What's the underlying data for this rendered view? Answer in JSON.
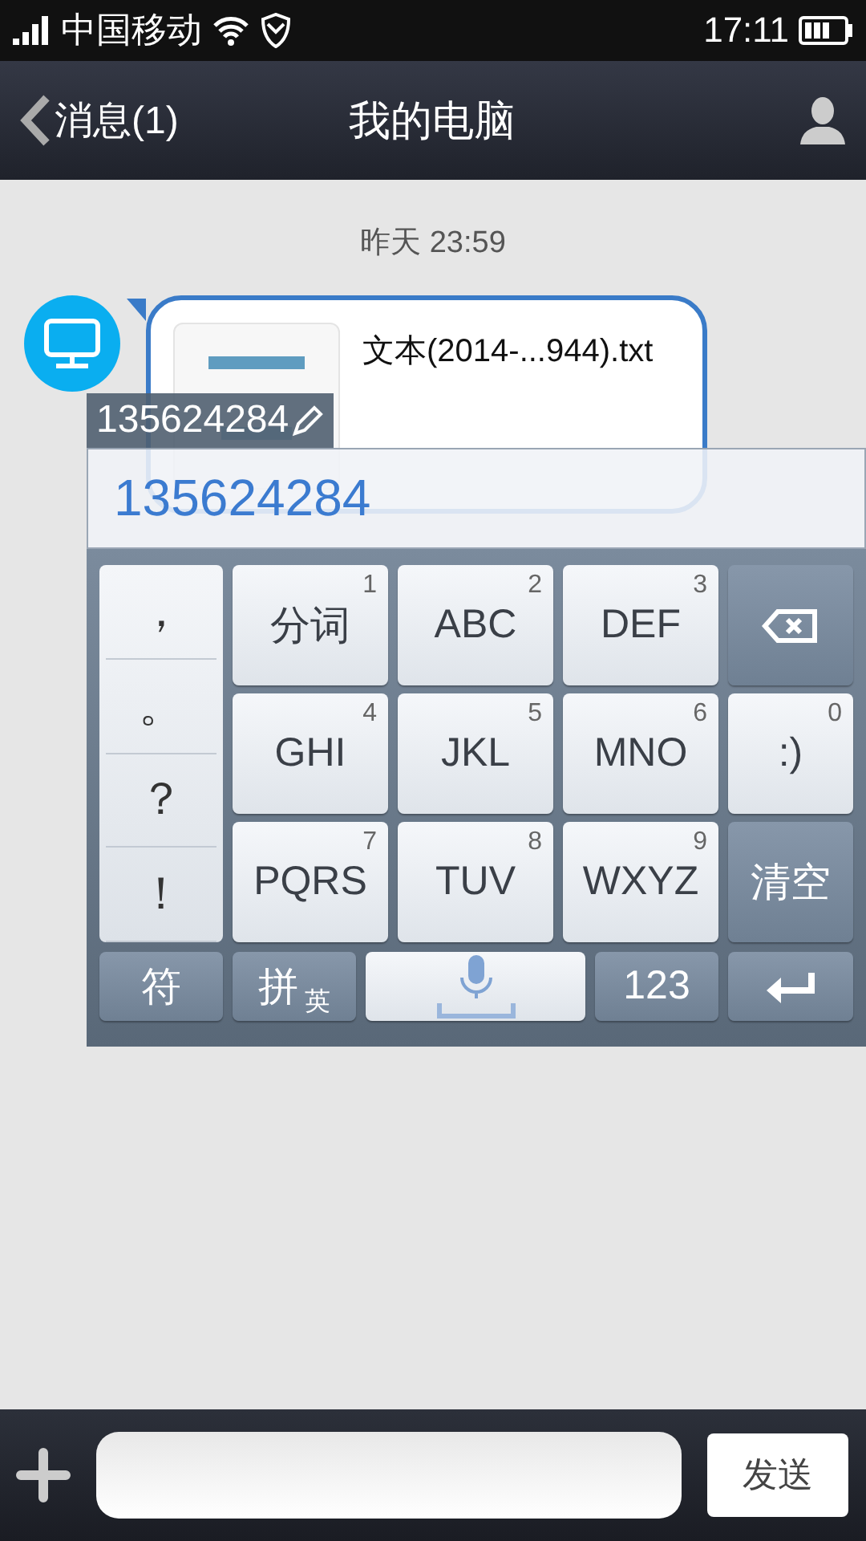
{
  "status_bar": {
    "carrier": "中国移动",
    "time": "17:11"
  },
  "nav_bar": {
    "back": "消息(1)",
    "title": "我的电脑"
  },
  "chat": {
    "timestamp": "昨天 23:59",
    "message": {
      "file_name": "文本(2014-...944).txt"
    }
  },
  "ime": {
    "composing": "135624284",
    "candidates": [
      "135624284"
    ],
    "punctuation": [
      "，",
      "。",
      "？",
      "！"
    ],
    "keys": [
      {
        "kind": "light",
        "label": "分词",
        "digit": "1"
      },
      {
        "kind": "light",
        "label": "ABC",
        "digit": "2"
      },
      {
        "kind": "light",
        "label": "DEF",
        "digit": "3"
      },
      {
        "kind": "backspace"
      },
      {
        "kind": "light",
        "label": "GHI",
        "digit": "4"
      },
      {
        "kind": "light",
        "label": "JKL",
        "digit": "5"
      },
      {
        "kind": "light",
        "label": "MNO",
        "digit": "6"
      },
      {
        "kind": "light",
        "label": ":)",
        "digit": "0"
      },
      {
        "kind": "light",
        "label": "PQRS",
        "digit": "7"
      },
      {
        "kind": "light",
        "label": "TUV",
        "digit": "8"
      },
      {
        "kind": "light",
        "label": "WXYZ",
        "digit": "9"
      },
      {
        "kind": "dark",
        "label": "清空"
      }
    ],
    "bottom_keys": [
      {
        "kind": "dark",
        "label": "符"
      },
      {
        "kind": "switch",
        "label": "拼",
        "sub": "英"
      },
      {
        "kind": "mic"
      },
      {
        "kind": "dark",
        "label": "123"
      },
      {
        "kind": "enter"
      }
    ]
  },
  "composer": {
    "send": "发送"
  }
}
